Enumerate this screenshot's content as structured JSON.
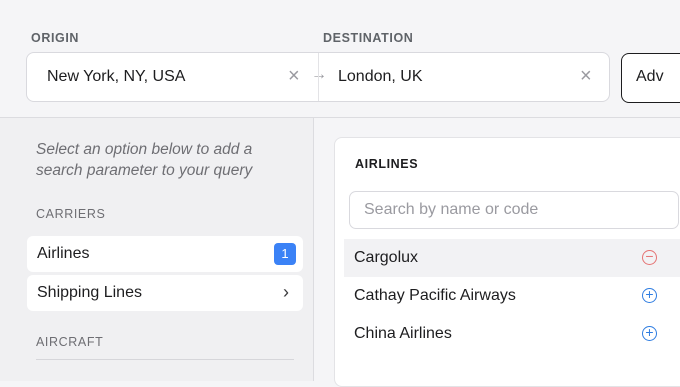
{
  "origin": {
    "label": "ORIGIN",
    "value": "New York, NY, USA"
  },
  "destination": {
    "label": "DESTINATION",
    "value": "London, UK"
  },
  "advanced_label": "Adv",
  "clear_glyph": "×",
  "arrow_glyph": "→",
  "sidebar": {
    "hint": "Select an option below to add a search parameter to your query",
    "carriers_label": "CARRIERS",
    "items": [
      {
        "label": "Airlines",
        "badge": "1"
      },
      {
        "label": "Shipping Lines",
        "chevron": "›"
      }
    ],
    "aircraft_label": "AIRCRAFT"
  },
  "airlines_panel": {
    "title": "AIRLINES",
    "search_placeholder": "Search by name or code",
    "rows": [
      {
        "label": "Cargolux",
        "icon": "minus-circle-icon",
        "glyph": "−"
      },
      {
        "label": "Cathay Pacific Airways",
        "icon": "plus-circle-icon",
        "glyph": "+"
      },
      {
        "label": "China Airlines",
        "icon": "plus-circle-icon",
        "glyph": "+"
      }
    ]
  },
  "colors": {
    "accent": "#3b82f6",
    "remove": "#e57373",
    "add": "#2f7de1"
  }
}
